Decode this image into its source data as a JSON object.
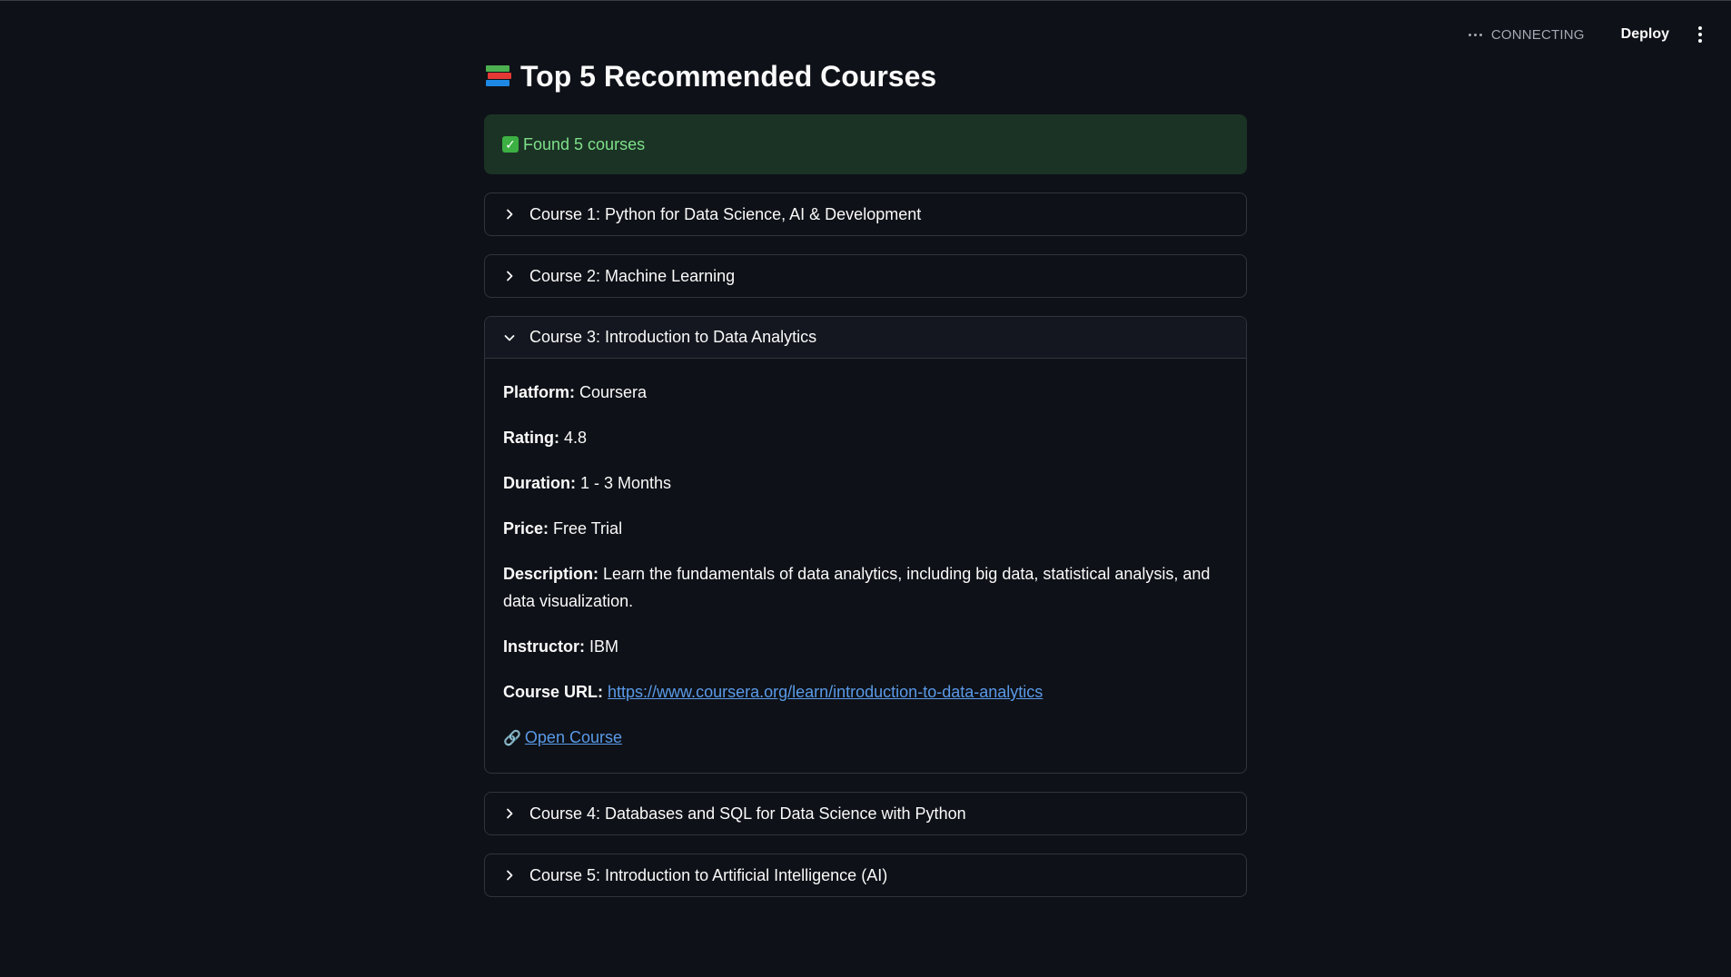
{
  "toolbar": {
    "status": "CONNECTING",
    "deploy_label": "Deploy"
  },
  "page": {
    "title": "Top 5 Recommended Courses",
    "title_icon": "books-icon"
  },
  "success": {
    "message": "Found 5 courses",
    "icon": "check-icon"
  },
  "courses": [
    {
      "label": "Course 1: Python for Data Science, AI & Development",
      "expanded": false
    },
    {
      "label": "Course 2: Machine Learning",
      "expanded": false
    },
    {
      "label": "Course 3: Introduction to Data Analytics",
      "expanded": true,
      "details": {
        "platform_label": "Platform:",
        "platform": "Coursera",
        "rating_label": "Rating:",
        "rating": "4.8",
        "duration_label": "Duration:",
        "duration": "1 - 3 Months",
        "price_label": "Price:",
        "price": "Free Trial",
        "description_label": "Description:",
        "description": "Learn the fundamentals of data analytics, including big data, statistical analysis, and data visualization.",
        "instructor_label": "Instructor:",
        "instructor": "IBM",
        "url_label": "Course URL:",
        "url": "https://www.coursera.org/learn/introduction-to-data-analytics",
        "open_label": "Open Course",
        "open_icon": "link-icon"
      }
    },
    {
      "label": "Course 4: Databases and SQL for Data Science with Python",
      "expanded": false
    },
    {
      "label": "Course 5: Introduction to Artificial Intelligence (AI)",
      "expanded": false
    }
  ],
  "colors": {
    "background": "#0e1117",
    "success_bg": "#1b3325",
    "success_text": "#7ee08a",
    "link": "#5a9ae8",
    "border": "#30343d"
  }
}
